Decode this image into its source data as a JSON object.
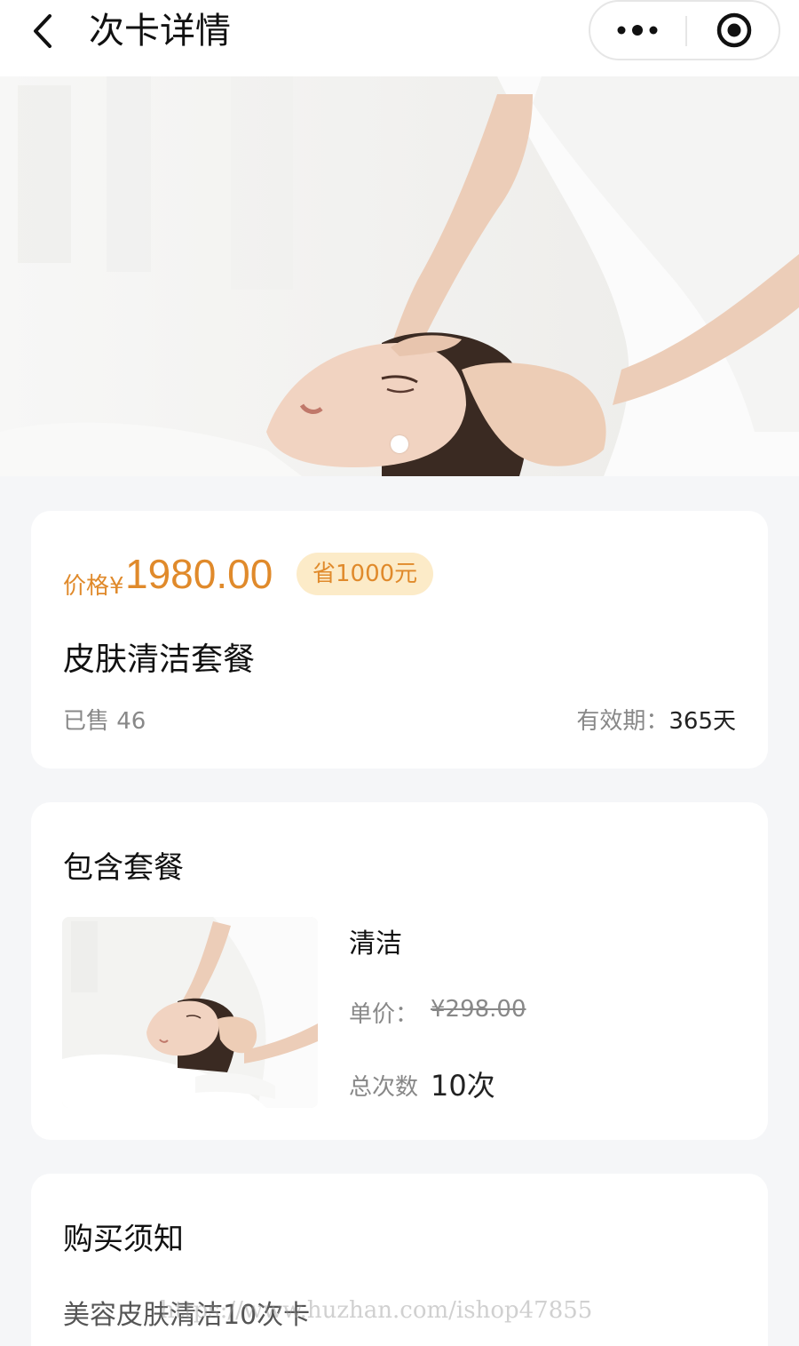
{
  "navbar": {
    "title": "次卡详情",
    "back_icon": "chevron-left-icon",
    "more_icon": "more-dots-icon",
    "close_icon": "target-close-icon"
  },
  "banner": {
    "image_desc": "massage-photo",
    "dots": 1,
    "active_dot": 0
  },
  "price_card": {
    "price_label": "价格¥",
    "price_value": "1980.00",
    "save_badge": "省1000元",
    "product_name": "皮肤清洁套餐",
    "sold_text": "已售 46",
    "validity_label": "有效期：",
    "validity_value": "365天"
  },
  "package_card": {
    "title": "包含套餐",
    "item": {
      "name": "清洁",
      "unit_price_label": "单价：",
      "unit_price": "¥298.00",
      "count_label": "总次数",
      "count_value": "10次"
    }
  },
  "notice_card": {
    "title": "购买须知",
    "text": "美容皮肤清洁10次卡"
  },
  "watermark": "https://www.huzhan.com/ishop47855",
  "colors": {
    "accent": "#e08a2b",
    "badge_bg": "#fcebc8",
    "page_bg": "#f5f6f8"
  }
}
